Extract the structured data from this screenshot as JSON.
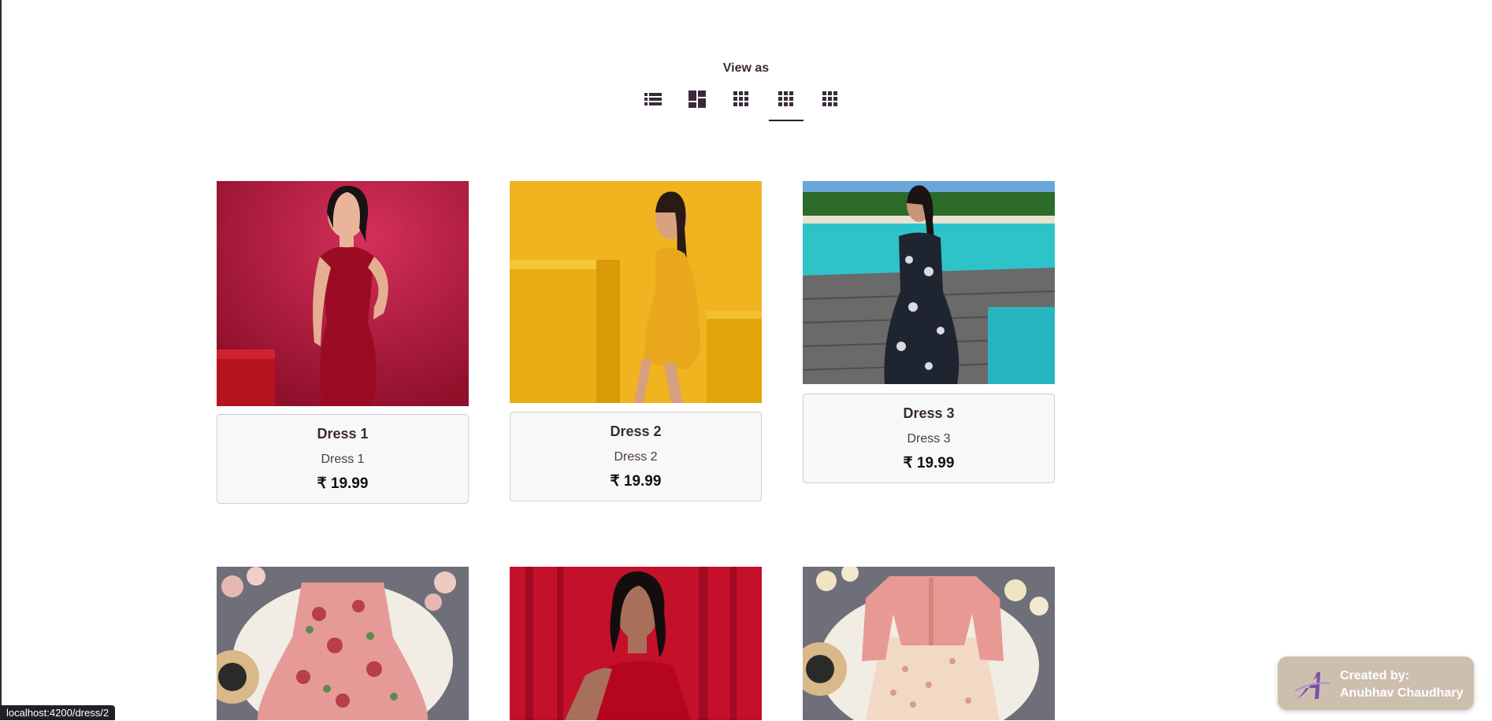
{
  "view_as": {
    "title": "View as",
    "options": [
      {
        "name": "list-view",
        "icon": "list-icon"
      },
      {
        "name": "masonry-view",
        "icon": "masonry-icon"
      },
      {
        "name": "grid-view-3",
        "icon": "grid-icon"
      },
      {
        "name": "grid-view-4",
        "icon": "grid-icon",
        "active": true
      },
      {
        "name": "grid-view-5",
        "icon": "grid-icon"
      }
    ]
  },
  "products": [
    {
      "name": "Dress 1",
      "description": "Dress 1",
      "price": "₹ 19.99"
    },
    {
      "name": "Dress 2",
      "description": "Dress 2",
      "price": "₹ 19.99"
    },
    {
      "name": "Dress 3",
      "description": "Dress 3",
      "price": "₹ 19.99"
    },
    {
      "name": "",
      "description": "",
      "price": ""
    },
    {
      "name": "",
      "description": "",
      "price": ""
    },
    {
      "name": "",
      "description": "",
      "price": ""
    }
  ],
  "credit": {
    "line1": "Created by:",
    "line2": "Anubhav Chaudhary"
  },
  "status_bar": {
    "url": "localhost:4200/dress/2"
  },
  "colors": {
    "accent": "#3b2a3a",
    "credit_bg": "#cdbfae"
  }
}
